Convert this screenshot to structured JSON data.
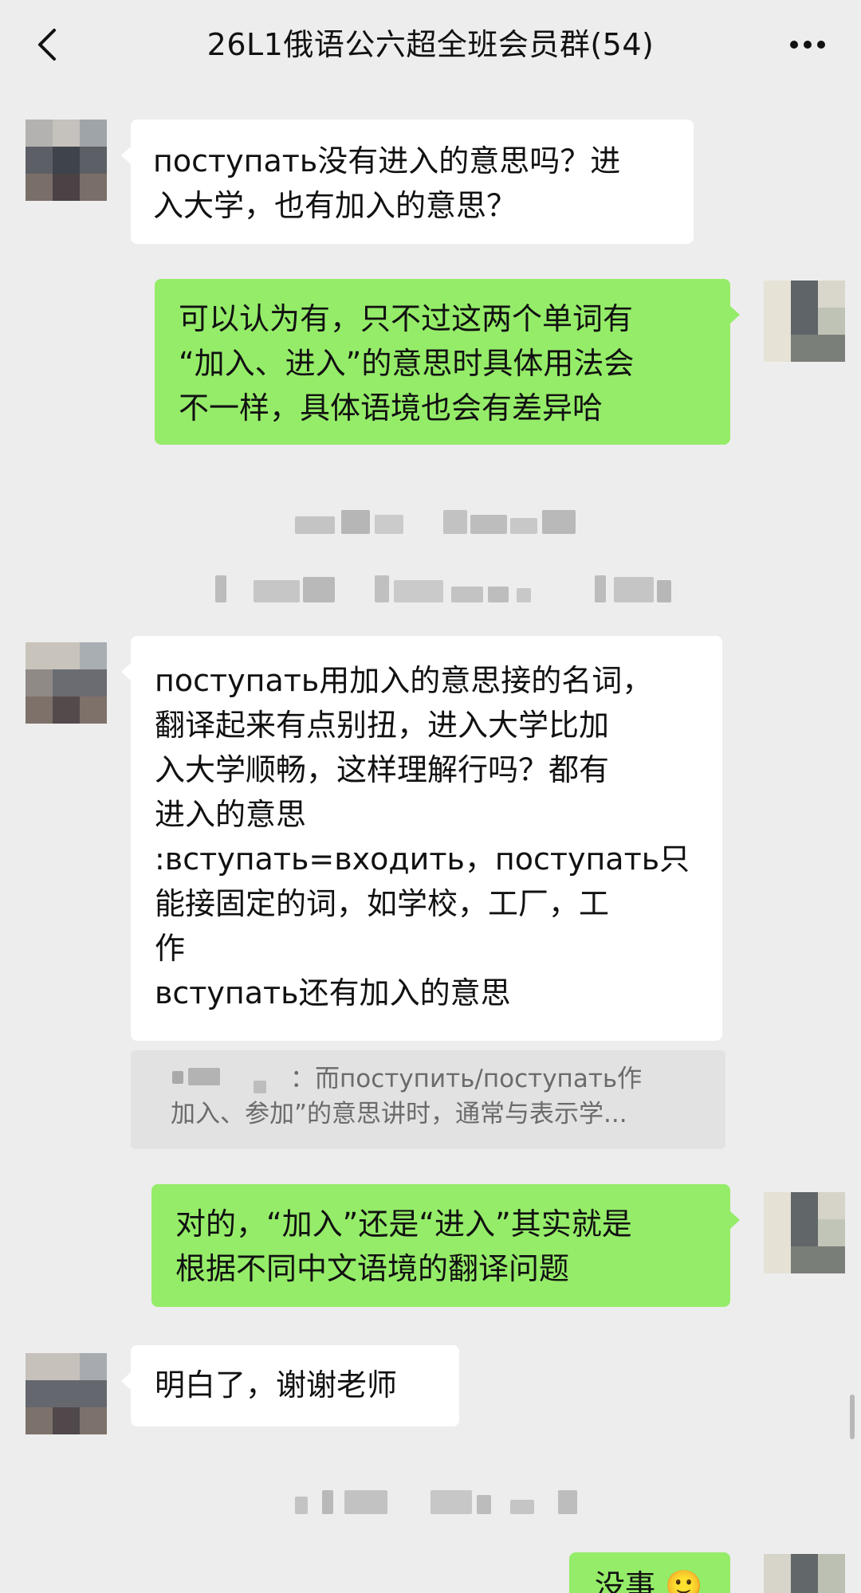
{
  "header": {
    "title": "26L1俄语公六超全班会员群(54)",
    "back_icon": "chevron-left-icon",
    "more_icon": "more-dots-icon"
  },
  "colors": {
    "background": "#ededed",
    "incoming_bubble": "#ffffff",
    "outgoing_bubble": "#95ec69",
    "quote_background": "#e2e2e2"
  },
  "messages": [
    {
      "side": "left",
      "text": "поступать没有进入的意思吗？进\n入大学，也有加入的意思？"
    },
    {
      "side": "right",
      "text": "可以认为有，只不过这两个单词有\n“加入、进入”的意思时具体用法会\n不一样，具体语境也会有差异哈"
    },
    {
      "side": "left",
      "text": "поступать用加入的意思接的名词，\n翻译起来有点别扭，进入大学比加\n入大学顺畅，这样理解行吗？都有\n进入的意思\n:вступать=входить，поступать只\n能接固定的词，如学校，工厂，工\n作\nвступать还有加入的意思"
    },
    {
      "side": "quote",
      "line1": "：而поступить/поступать作",
      "line2": "加入、参加”的意思讲时，通常与表示学..."
    },
    {
      "side": "right",
      "text": "对的，“加入”还是“进入”其实就是\n根据不同中文语境的翻译问题"
    },
    {
      "side": "left",
      "text": "明白了，谢谢老师"
    },
    {
      "side": "right",
      "text": "没事 🙂"
    }
  ]
}
